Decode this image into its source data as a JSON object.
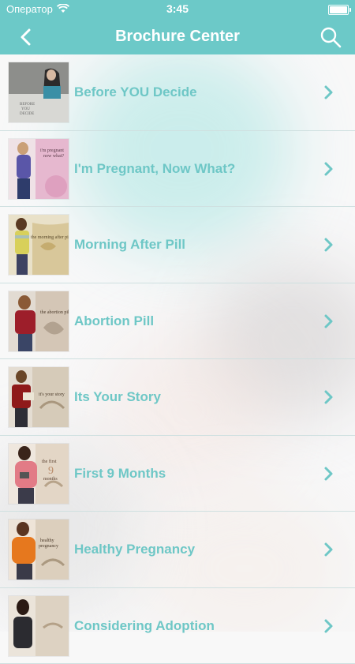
{
  "status_bar": {
    "carrier": "Оператор",
    "time": "3:45"
  },
  "nav": {
    "title": "Brochure Center",
    "back_icon": "chevron-left-icon",
    "search_icon": "search-icon"
  },
  "colors": {
    "accent": "#6cc9c8",
    "label": "#6ec7c6",
    "chevron": "#6ec7c6"
  },
  "brochures": [
    {
      "label": "Before YOU Decide",
      "thumb_text": "BEFORE YOU DECIDE"
    },
    {
      "label": "I'm Pregnant, Now What?",
      "thumb_text": "i'm pregnant now what?"
    },
    {
      "label": "Morning After Pill",
      "thumb_text": "the morning after pill"
    },
    {
      "label": "Abortion Pill",
      "thumb_text": "the abortion pill"
    },
    {
      "label": "Its Your Story",
      "thumb_text": "it's your story"
    },
    {
      "label": "First 9 Months",
      "thumb_text": "the first 9 months"
    },
    {
      "label": "Healthy Pregnancy",
      "thumb_text": "healthy pregnancy"
    },
    {
      "label": "Considering Adoption",
      "thumb_text": ""
    }
  ]
}
